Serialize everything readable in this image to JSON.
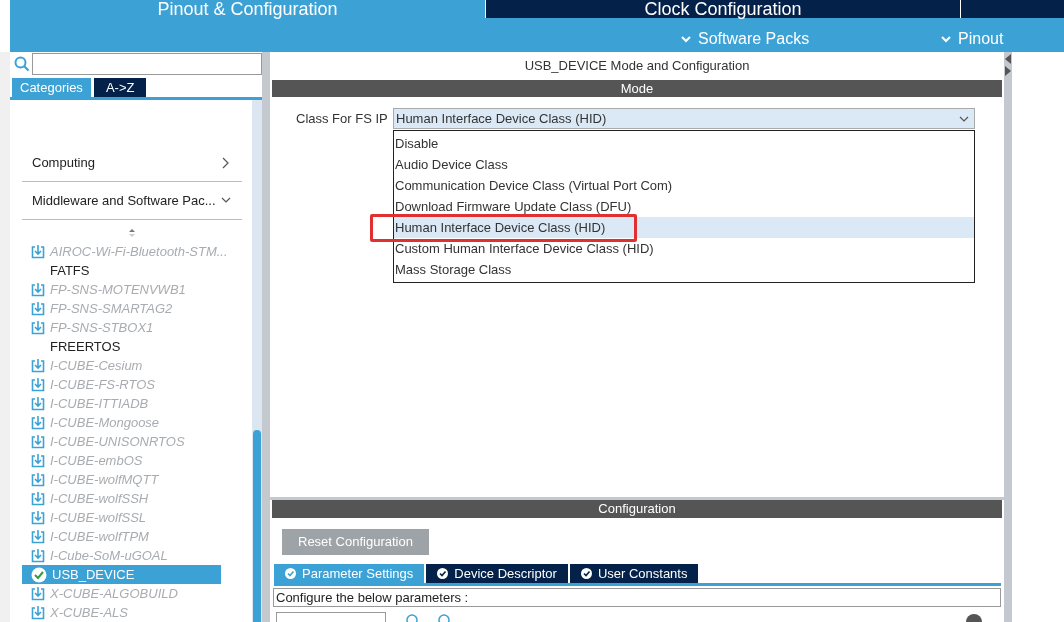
{
  "top_tabs": [
    {
      "label": "Pinout & Configuration",
      "selected": true
    },
    {
      "label": "Clock Configuration",
      "selected": false
    }
  ],
  "sub_menu": [
    {
      "label": "Software Packs"
    },
    {
      "label": "Pinout"
    }
  ],
  "sidebar": {
    "view_tabs": [
      {
        "label": "Categories",
        "selected": true
      },
      {
        "label": "A->Z",
        "selected": false
      }
    ],
    "categories": [
      {
        "label": "Computing",
        "expanded": false
      },
      {
        "label": "Middleware and Software Pac...",
        "expanded": true
      }
    ],
    "items": [
      {
        "label": "AIROC-Wi-Fi-Bluetooth-STM...",
        "kind": "pack",
        "selected": false
      },
      {
        "label": "FATFS",
        "kind": "plain",
        "selected": false
      },
      {
        "label": "FP-SNS-MOTENVWB1",
        "kind": "pack",
        "selected": false
      },
      {
        "label": "FP-SNS-SMARTAG2",
        "kind": "pack",
        "selected": false
      },
      {
        "label": "FP-SNS-STBOX1",
        "kind": "pack",
        "selected": false
      },
      {
        "label": "FREERTOS",
        "kind": "plain",
        "selected": false
      },
      {
        "label": "I-CUBE-Cesium",
        "kind": "pack",
        "selected": false
      },
      {
        "label": "I-CUBE-FS-RTOS",
        "kind": "pack",
        "selected": false
      },
      {
        "label": "I-CUBE-ITTIADB",
        "kind": "pack",
        "selected": false
      },
      {
        "label": "I-CUBE-Mongoose",
        "kind": "pack",
        "selected": false
      },
      {
        "label": "I-CUBE-UNISONRTOS",
        "kind": "pack",
        "selected": false
      },
      {
        "label": "I-CUBE-embOS",
        "kind": "pack",
        "selected": false
      },
      {
        "label": "I-CUBE-wolfMQTT",
        "kind": "pack",
        "selected": false
      },
      {
        "label": "I-CUBE-wolfSSH",
        "kind": "pack",
        "selected": false
      },
      {
        "label": "I-CUBE-wolfSSL",
        "kind": "pack",
        "selected": false
      },
      {
        "label": "I-CUBE-wolfTPM",
        "kind": "pack",
        "selected": false
      },
      {
        "label": "I-Cube-SoM-uGOAL",
        "kind": "pack",
        "selected": false
      },
      {
        "label": "USB_DEVICE",
        "kind": "enabled",
        "selected": true
      },
      {
        "label": "X-CUBE-ALGOBUILD",
        "kind": "pack",
        "selected": false
      },
      {
        "label": "X-CUBE-ALS",
        "kind": "pack",
        "selected": false
      }
    ]
  },
  "main": {
    "title": "USB_DEVICE Mode and Configuration",
    "mode": {
      "heading": "Mode",
      "field_label": "Class For FS IP",
      "value": "Human Interface Device Class (HID)",
      "options": [
        {
          "label": "Disable",
          "selected": false
        },
        {
          "label": "Audio Device Class",
          "selected": false
        },
        {
          "label": "Communication Device Class (Virtual Port Com)",
          "selected": false
        },
        {
          "label": "Download Firmware Update Class (DFU)",
          "selected": false
        },
        {
          "label": "Human Interface Device Class (HID)",
          "selected": true
        },
        {
          "label": "Custom Human Interface Device Class (HID)",
          "selected": false
        },
        {
          "label": "Mass Storage Class",
          "selected": false
        }
      ]
    },
    "configuration": {
      "heading": "Configuration",
      "reset_button": "Reset Configuration",
      "tabs": [
        {
          "label": "Parameter Settings",
          "selected": true
        },
        {
          "label": "Device Descriptor",
          "selected": false
        },
        {
          "label": "User Constants",
          "selected": false
        }
      ],
      "hint": "Configure the below parameters :"
    }
  }
}
